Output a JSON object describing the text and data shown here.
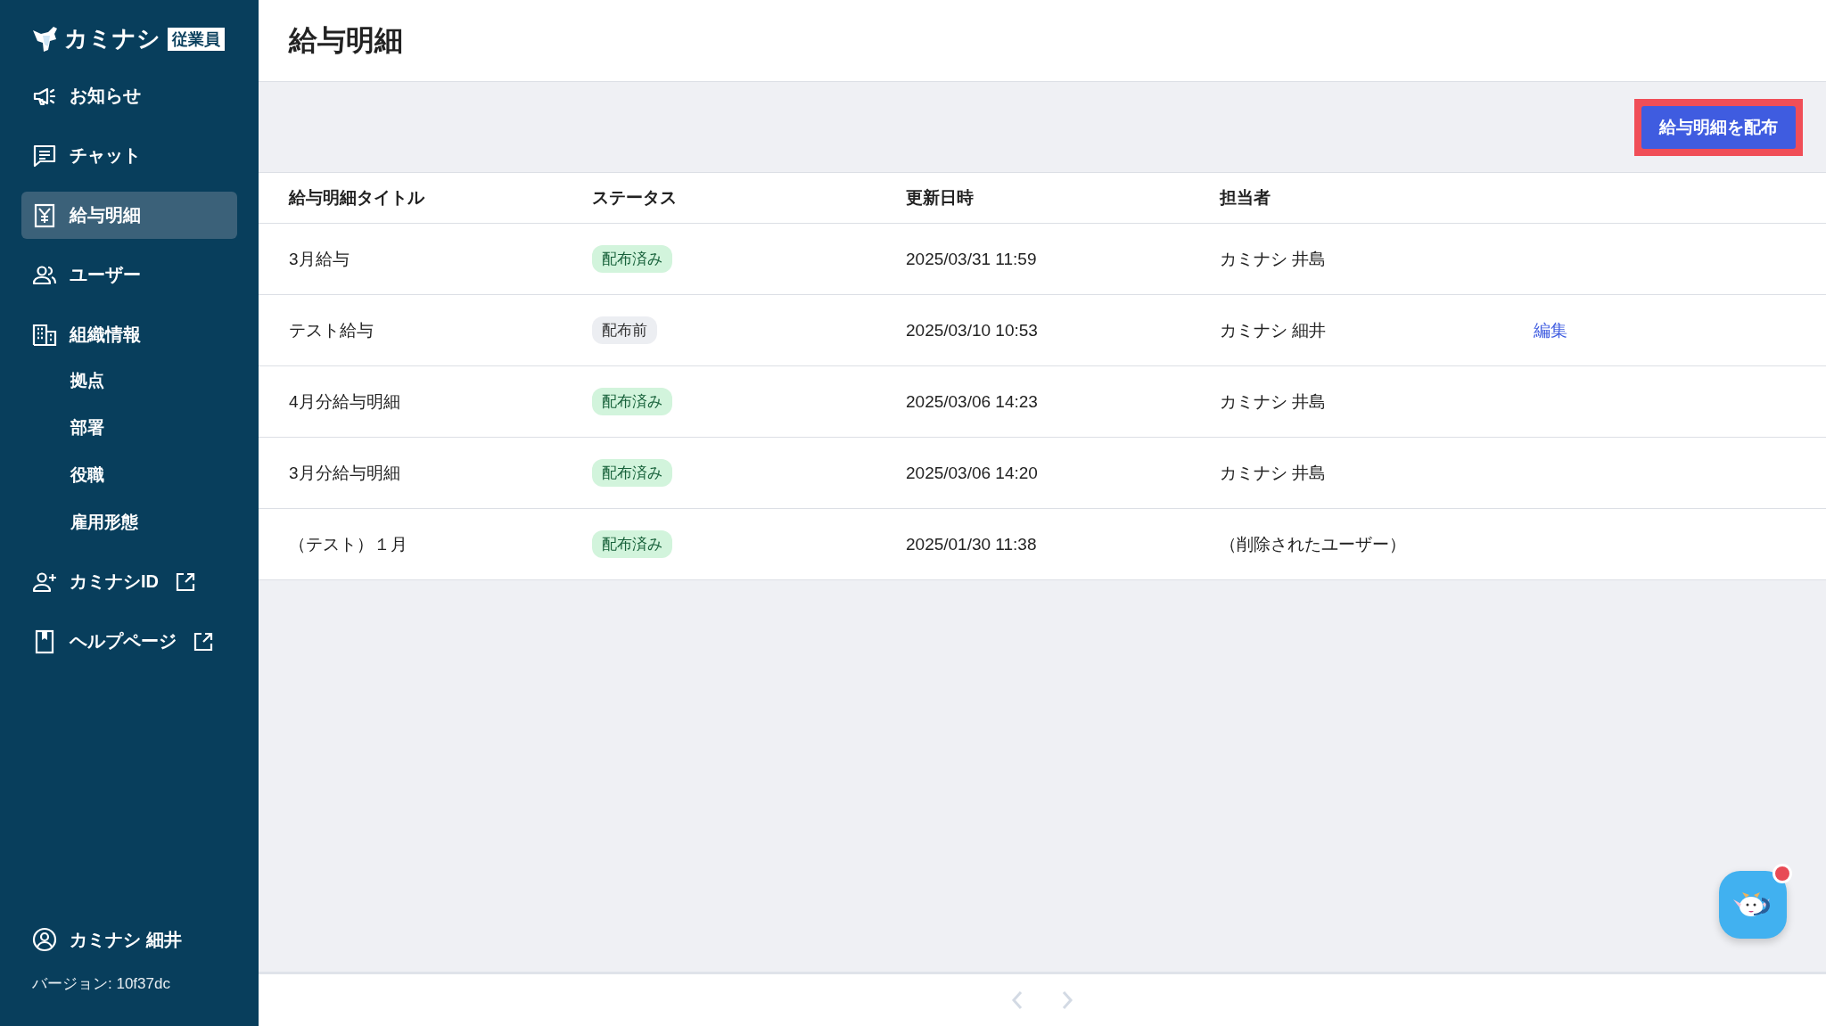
{
  "sidebar": {
    "logo": {
      "name": "カミナシ",
      "badge": "従業員"
    },
    "items": [
      {
        "label": "お知らせ",
        "selected": false,
        "external": false
      },
      {
        "label": "チャット",
        "selected": false,
        "external": false
      },
      {
        "label": "給与明細",
        "selected": true,
        "external": false
      },
      {
        "label": "ユーザー",
        "selected": false,
        "external": false
      },
      {
        "label": "組織情報",
        "selected": false,
        "external": false,
        "children": [
          {
            "label": "拠点",
            "selected": false
          },
          {
            "label": "部署",
            "selected": false
          },
          {
            "label": "役職",
            "selected": false
          },
          {
            "label": "雇用形態",
            "selected": false
          }
        ]
      },
      {
        "label": "カミナシID",
        "selected": false,
        "external": true
      },
      {
        "label": "ヘルプページ",
        "selected": false,
        "external": true
      }
    ],
    "user": {
      "name": "カミナシ 細井"
    },
    "version": "バージョン: 10f37dc"
  },
  "page": {
    "title": "給与明細",
    "primary_button": {
      "label": "給与明細を配布",
      "highlighted": true
    }
  },
  "table": {
    "columns": [
      "給与明細タイトル",
      "ステータス",
      "更新日時",
      "担当者"
    ],
    "rows": [
      {
        "title": "3月給与",
        "status": {
          "label": "配布済み",
          "kind": "distributed"
        },
        "updated": "2025/03/31 11:59",
        "owner": "カミナシ 井島"
      },
      {
        "title": "テスト給与",
        "status": {
          "label": "配布前",
          "kind": "draft"
        },
        "updated": "2025/03/10 10:53",
        "owner": "カミナシ 細井",
        "action": "編集"
      },
      {
        "title": "4月分給与明細",
        "status": {
          "label": "配布済み",
          "kind": "distributed"
        },
        "updated": "2025/03/06 14:23",
        "owner": "カミナシ 井島"
      },
      {
        "title": "3月分給与明細",
        "status": {
          "label": "配布済み",
          "kind": "distributed"
        },
        "updated": "2025/03/06 14:20",
        "owner": "カミナシ 井島"
      },
      {
        "title": "（テスト）１月",
        "status": {
          "label": "配布済み",
          "kind": "distributed"
        },
        "updated": "2025/01/30 11:38",
        "owner": "（削除されたユーザー）"
      }
    ]
  },
  "pagination": {
    "prev_disabled": true,
    "next_disabled": true
  },
  "chat_widget": {
    "notification": true
  }
}
